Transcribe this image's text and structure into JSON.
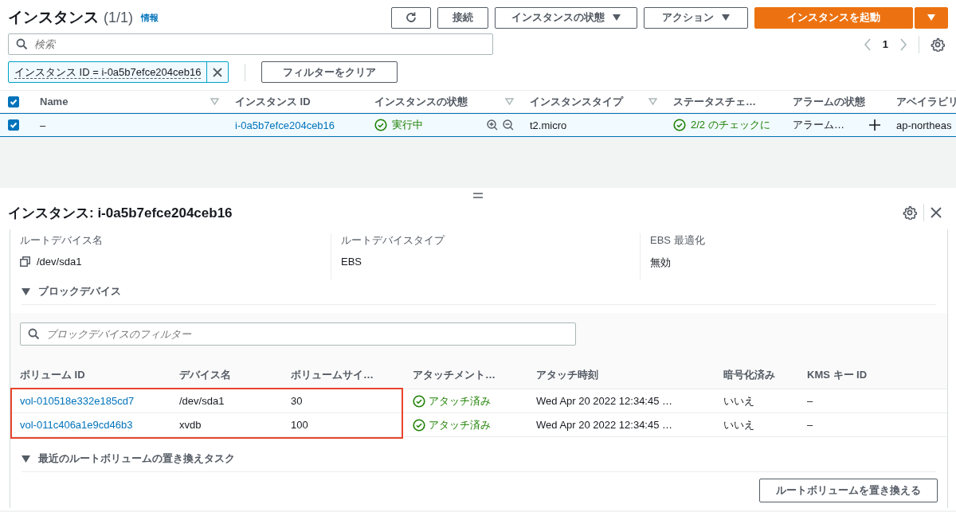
{
  "header": {
    "title": "インスタンス",
    "count": "(1/1)",
    "info_link": "情報"
  },
  "toolbar": [
    {
      "kind": "refresh"
    },
    {
      "kind": "plain",
      "label": "接続"
    },
    {
      "kind": "dropdown",
      "label": "インスタンスの状態"
    },
    {
      "kind": "dropdown",
      "label": "アクション"
    },
    {
      "kind": "primary",
      "label": "インスタンスを起動"
    },
    {
      "kind": "primary_dropdown"
    }
  ],
  "search": {
    "placeholder": "検索"
  },
  "pagination": {
    "page": "1"
  },
  "filter_token": {
    "text": "インスタンス ID = i-0a5b7efce204ceb16"
  },
  "clear_filters_button": "フィルターをクリア",
  "instances_table": {
    "all_checked": true,
    "columns": [
      {
        "label": "Name",
        "sortable": true
      },
      {
        "label": "インスタンス ID",
        "sortable": false
      },
      {
        "label": "インスタンスの状態",
        "sortable": true
      },
      {
        "label": "インスタンスタイプ",
        "sortable": true
      },
      {
        "label": "ステータスチェ…",
        "sortable": false
      },
      {
        "label": "アラームの状態",
        "sortable": false
      },
      {
        "label": "アベイラビリ"
      }
    ],
    "rows": [
      {
        "checked": true,
        "selected": true,
        "name": "–",
        "instance_id": "i-0a5b7efce204ceb16",
        "state": "実行中",
        "instance_type": "t2.micro",
        "status_check": "2/2 のチェックに",
        "alarm": "アラーム…",
        "availability_zone": "ap-northeas"
      }
    ]
  },
  "details": {
    "title": "インスタンス: i-0a5b7efce204ceb16",
    "fields": [
      {
        "label": "ルートデバイス名",
        "value": "/dev/sda1",
        "copyable": true
      },
      {
        "label": "ルートデバイスタイプ",
        "value": "EBS",
        "copyable": false
      },
      {
        "label": "EBS 最適化",
        "value": "無効",
        "copyable": false
      }
    ],
    "block_devices": {
      "title": "ブロックデバイス",
      "expanded": true,
      "filter_placeholder": "ブロックデバイスのフィルター",
      "columns": [
        "ボリューム ID",
        "デバイス名",
        "ボリュームサイ…",
        "アタッチメント…",
        "アタッチ時刻",
        "暗号化済み",
        "KMS キー ID"
      ],
      "rows": [
        {
          "volume_id": "vol-010518e332e185cd7",
          "device": "/dev/sda1",
          "size": "30",
          "attachment_status": "アタッチ済み",
          "attach_time": "Wed Apr 20 2022 12:34:45 …",
          "encrypted": "いいえ",
          "kms_key_id": "–",
          "highlighted": true
        },
        {
          "volume_id": "vol-011c406a1e9cd46b3",
          "device": "xvdb",
          "size": "100",
          "attachment_status": "アタッチ済み",
          "attach_time": "Wed Apr 20 2022 12:34:45 …",
          "encrypted": "いいえ",
          "kms_key_id": "–",
          "highlighted": true
        }
      ]
    },
    "replace_tasks": {
      "title": "最近のルートボリュームの置き換えタスク",
      "expanded": true,
      "button": "ルートボリュームを置き換える"
    }
  }
}
